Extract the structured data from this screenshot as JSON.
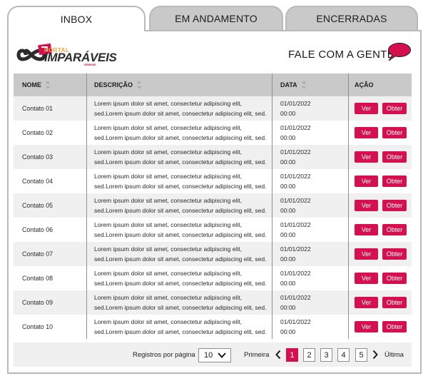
{
  "tabs": [
    {
      "label": "INBOX",
      "active": true
    },
    {
      "label": "EM ANDAMENTO",
      "active": false
    },
    {
      "label": "ENCERRADAS",
      "active": false
    }
  ],
  "header": {
    "logo_top": "PORTAL",
    "logo_main": "IMPARÁVEIS",
    "logo_tiny": "SEBRAE",
    "fale": "FALE COM A GENTE",
    "chat_icon": "chat-bubble-icon"
  },
  "colors": {
    "accent": "#d6104f",
    "tab_inactive": "#c9c9c9",
    "row_alt": "#f0f0f0"
  },
  "table": {
    "headers": {
      "nome": "NOME",
      "descricao": "DESCRIÇÃO",
      "data": "DATA",
      "acao": "AÇÃO"
    },
    "rows": [
      {
        "nome": "Contato 01",
        "desc1": "Lorem ipsum dolor sit amet, consectetur adipiscing elit,",
        "desc2": "sed.Lorem ipsum dolor sit amet, consectetur adipiscing elit, sed.",
        "date": "01/01/2022",
        "time": "00:00",
        "ver": "Ver",
        "obter": "Obter"
      },
      {
        "nome": "Contato 02",
        "desc1": "Lorem ipsum dolor sit amet, consectetur adipiscing elit,",
        "desc2": "sed.Lorem ipsum dolor sit amet, consectetur adipiscing elit, sed.",
        "date": "01/01/2022",
        "time": "00:00",
        "ver": "Ver",
        "obter": "Obter"
      },
      {
        "nome": "Contato 03",
        "desc1": "Lorem ipsum dolor sit amet, consectetur adipiscing elit,",
        "desc2": "sed.Lorem ipsum dolor sit amet, consectetur adipiscing elit, sed.",
        "date": "01/01/2022",
        "time": "00:00",
        "ver": "Ver",
        "obter": "Obter"
      },
      {
        "nome": "Contato 04",
        "desc1": "Lorem ipsum dolor sit amet, consectetur adipiscing elit,",
        "desc2": "sed.Lorem ipsum dolor sit amet, consectetur adipiscing elit, sed.",
        "date": "01/01/2022",
        "time": "00:00",
        "ver": "Ver",
        "obter": "Obter"
      },
      {
        "nome": "Contato 05",
        "desc1": "Lorem ipsum dolor sit amet, consectetur adipiscing elit,",
        "desc2": "sed.Lorem ipsum dolor sit amet, consectetur adipiscing elit, sed.",
        "date": "01/01/2022",
        "time": "00:00",
        "ver": "Ver",
        "obter": "Obter"
      },
      {
        "nome": "Contato 06",
        "desc1": "Lorem ipsum dolor sit amet, consectetur adipiscing elit,",
        "desc2": "sed.Lorem ipsum dolor sit amet, consectetur adipiscing elit, sed.",
        "date": "01/01/2022",
        "time": "00:00",
        "ver": "Ver",
        "obter": "Obter"
      },
      {
        "nome": "Contato 07",
        "desc1": "Lorem ipsum dolor sit amet, consectetur adipiscing elit,",
        "desc2": "sed.Lorem ipsum dolor sit amet, consectetur adipiscing elit, sed.",
        "date": "01/01/2022",
        "time": "00:00",
        "ver": "Ver",
        "obter": "Obter"
      },
      {
        "nome": "Contato 08",
        "desc1": "Lorem ipsum dolor sit amet, consectetur adipiscing elit,",
        "desc2": "sed.Lorem ipsum dolor sit amet, consectetur adipiscing elit, sed.",
        "date": "01/01/2022",
        "time": "00:00",
        "ver": "Ver",
        "obter": "Obter"
      },
      {
        "nome": "Contato 09",
        "desc1": "Lorem ipsum dolor sit amet, consectetur adipiscing elit,",
        "desc2": "sed.Lorem ipsum dolor sit amet, consectetur adipiscing elit, sed.",
        "date": "01/01/2022",
        "time": "00:00",
        "ver": "Ver",
        "obter": "Obter"
      },
      {
        "nome": "Contato 10",
        "desc1": "Lorem ipsum dolor sit amet, consectetur adipiscing elit,",
        "desc2": "sed.Lorem ipsum dolor sit amet, consectetur adipiscing elit, sed.",
        "date": "01/01/2022",
        "time": "00:00",
        "ver": "Ver",
        "obter": "Obter"
      }
    ]
  },
  "pagination": {
    "per_page_label": "Registros por página",
    "per_page_value": "10",
    "first": "Primeira",
    "last": "Última",
    "pages": [
      "1",
      "2",
      "3",
      "4",
      "5"
    ],
    "current": "1"
  }
}
